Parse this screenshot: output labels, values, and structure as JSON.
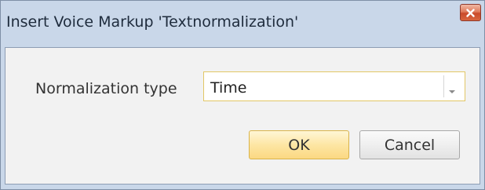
{
  "window": {
    "title": "Insert Voice Markup 'Textnormalization'",
    "close_icon": "close-icon"
  },
  "form": {
    "normalization_label": "Normalization type",
    "normalization_value": "Time",
    "dropdown_icon": "chevron-down-icon"
  },
  "buttons": {
    "ok_label": "OK",
    "cancel_label": "Cancel"
  },
  "colors": {
    "ok_accent": "#fde6a4",
    "close_accent": "#d8663f",
    "frame": "#c9d7e9"
  }
}
